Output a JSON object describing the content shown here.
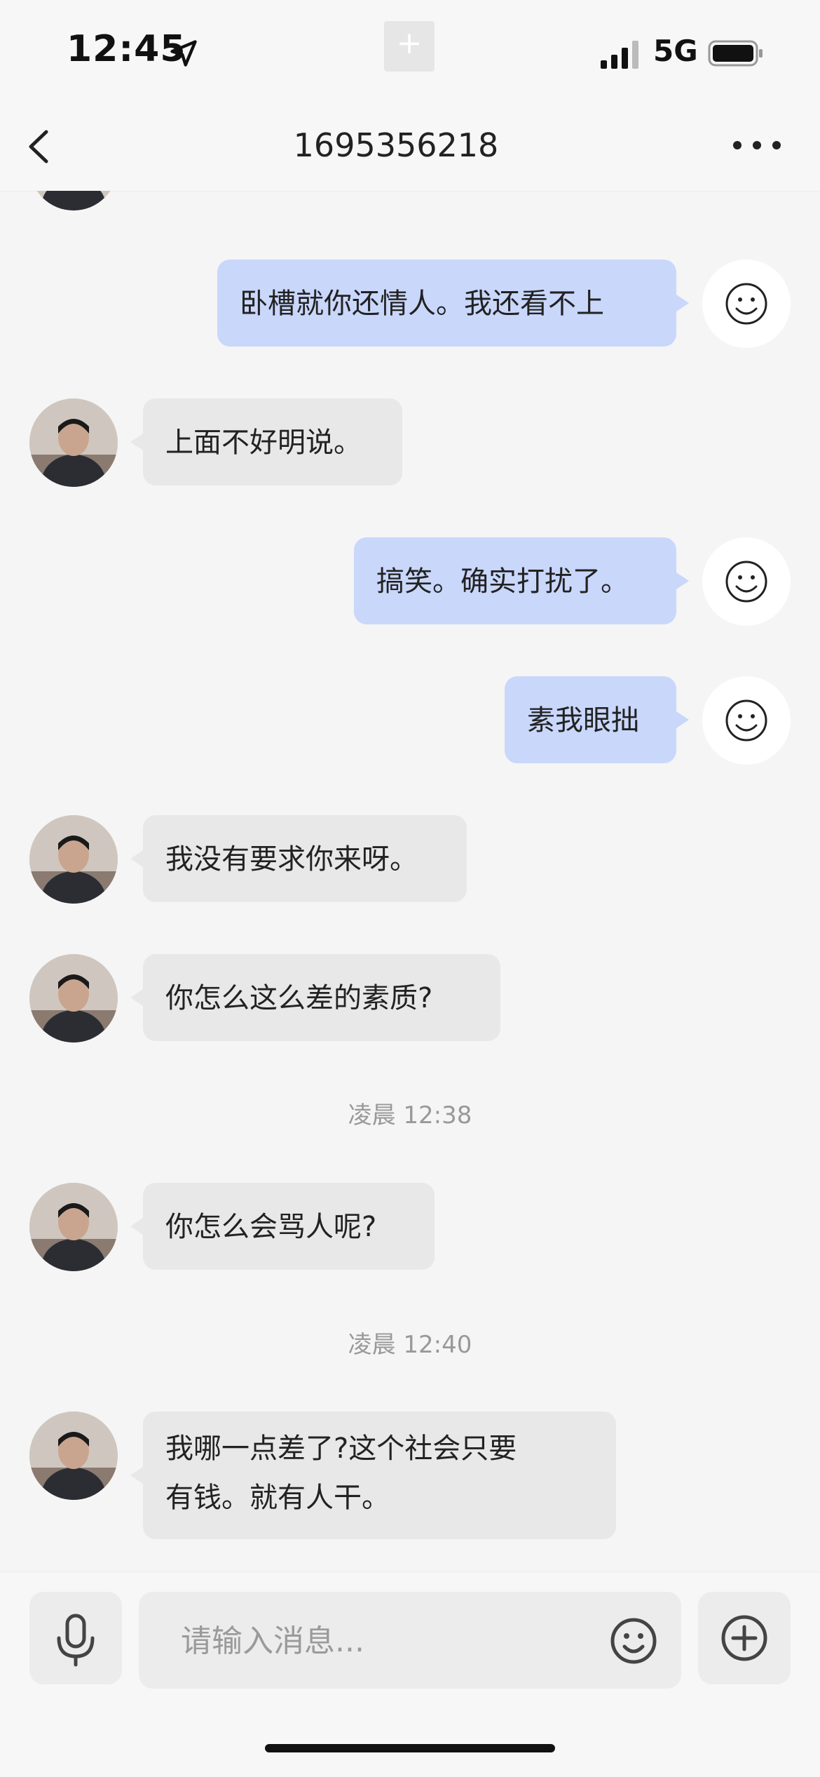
{
  "status_bar": {
    "time": "12:45",
    "network": "5G"
  },
  "nav": {
    "title": "1695356218"
  },
  "messages": [
    {
      "side": "left",
      "text": ""
    },
    {
      "side": "right",
      "text": "卧槽就你还情人。我还看不上"
    },
    {
      "side": "left",
      "text": "上面不好明说。"
    },
    {
      "side": "right",
      "text": "搞笑。确实打扰了。"
    },
    {
      "side": "right",
      "text": "素我眼拙"
    },
    {
      "side": "left",
      "text": "我没有要求你来呀。"
    },
    {
      "side": "left",
      "text": "你怎么这么差的素质?"
    },
    {
      "type": "time",
      "text": "凌晨 12:38"
    },
    {
      "side": "left",
      "text": "你怎么会骂人呢?"
    },
    {
      "type": "time",
      "text": "凌晨 12:40"
    },
    {
      "side": "left",
      "lines": [
        "我哪一点差了?这个社会只要",
        "有钱。就有人干。"
      ]
    }
  ],
  "input": {
    "placeholder": "请输入消息..."
  },
  "icons": {
    "back": "chevron-left-icon",
    "more": "more-dots-icon",
    "mic": "microphone-icon",
    "emoji": "smiley-icon",
    "plus": "plus-circle-icon",
    "location": "location-arrow-icon",
    "signal": "signal-bars-icon",
    "battery": "battery-icon"
  },
  "colors": {
    "my_bubble": "#c9d7fb",
    "their_bubble": "#e8e8e8",
    "background": "#f5f5f5"
  }
}
